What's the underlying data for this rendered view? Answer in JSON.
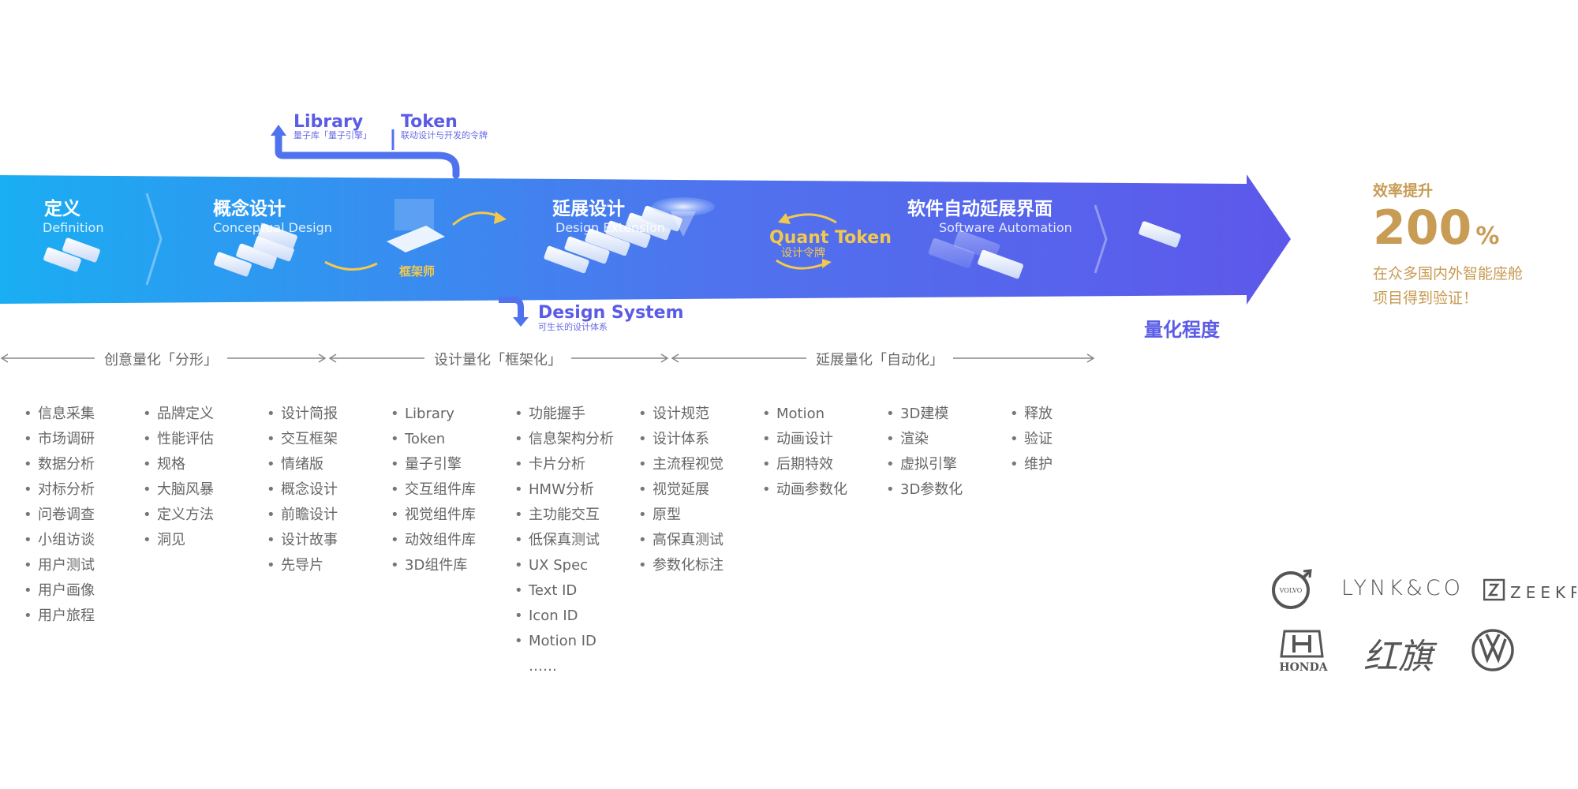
{
  "stages": [
    {
      "title": "定义",
      "subtitle": "Definition"
    },
    {
      "title": "概念设计",
      "subtitle": "Conceptual Design"
    },
    {
      "title": "延展设计",
      "subtitle": "Design Extension"
    },
    {
      "title": "软件自动延展界面",
      "subtitle": "Software Automation"
    }
  ],
  "callouts": {
    "library": {
      "title": "Library",
      "subtitle": "量子库「量子引擎」"
    },
    "token": {
      "title": "Token",
      "subtitle": "联动设计与开发的令牌"
    },
    "design_system": {
      "title": "Design System",
      "subtitle": "可生长的设计体系"
    },
    "quant_token": {
      "title": "Quant Token",
      "subtitle": "设计令牌"
    },
    "framer": "框架师"
  },
  "axis_label": "量化程度",
  "phases": [
    {
      "label": "创意量化「分形」"
    },
    {
      "label": "设计量化「框架化」"
    },
    {
      "label": "延展量化「自动化」"
    }
  ],
  "columns": [
    [
      "信息采集",
      "市场调研",
      "数据分析",
      "对标分析",
      "问卷调查",
      "小组访谈",
      "用户测试",
      "用户画像",
      "用户旅程"
    ],
    [
      "品牌定义",
      "性能评估",
      "规格",
      "大脑风暴",
      "定义方法",
      "洞见"
    ],
    [
      "设计简报",
      "交互框架",
      "情绪版",
      "概念设计",
      "前瞻设计",
      "设计故事",
      "先导片"
    ],
    [
      "Library",
      "Token",
      "量子引擎",
      "交互组件库",
      "视觉组件库",
      "动效组件库",
      "3D组件库"
    ],
    [
      "功能握手",
      "信息架构分析",
      "卡片分析",
      "HMW分析",
      "主功能交互",
      "低保真测试",
      "UX Spec",
      "Text ID",
      "Icon ID",
      "Motion ID"
    ],
    [
      "设计规范",
      "设计体系",
      "主流程视觉",
      "视觉延展",
      "原型",
      "高保真测试",
      "参数化标注"
    ],
    [
      "Motion",
      "动画设计",
      "后期特效",
      "动画参数化"
    ],
    [
      "3D建模",
      "渲染",
      "虚拟引擎",
      "3D参数化"
    ],
    [
      "释放",
      "验证",
      "维护"
    ]
  ],
  "column_ellipsis": "……",
  "efficiency": {
    "title": "效率提升",
    "value": "200",
    "unit": "%",
    "note_line1": "在众多国内外智能座舱",
    "note_line2": "项目得到验证！"
  },
  "logos": [
    "VOLVO",
    "LYNK&CO",
    "ZEEKR",
    "HONDA",
    "红旗",
    "VW"
  ],
  "colors": {
    "arrow_start": "#1aaef2",
    "arrow_end": "#5d58ea",
    "accent": "#5b5ce6",
    "gold": "#f2c94c",
    "efficiency": "#c89c55"
  }
}
